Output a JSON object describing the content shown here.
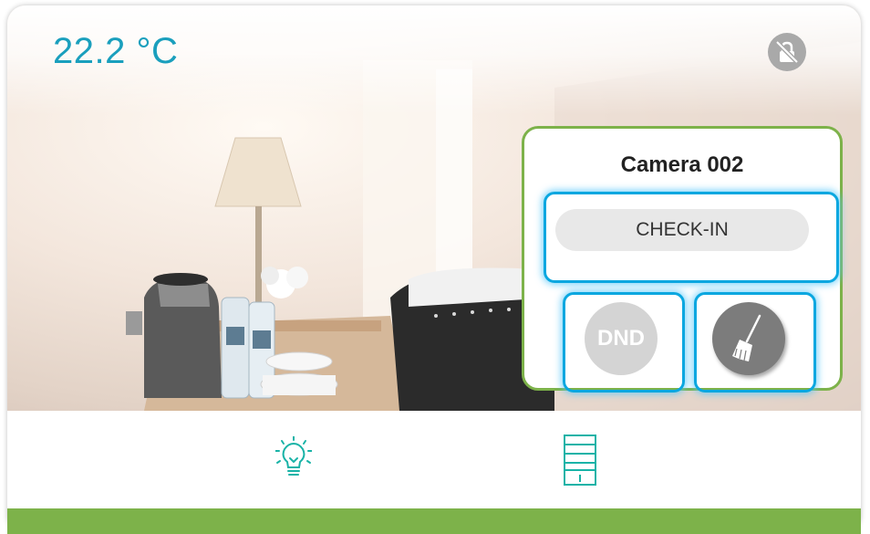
{
  "temperature": {
    "value": "22.2 °C"
  },
  "panel": {
    "title": "Camera 002",
    "checkin_label": "CHECK-IN",
    "dnd_label": "DND"
  },
  "icons": {
    "lock": "lock-crossed-icon",
    "broom": "broom-icon",
    "light": "light-bulb-icon",
    "blind": "blind-shutter-icon"
  },
  "colors": {
    "accent": "#1a9fbd",
    "green": "#7db24a",
    "highlight": "#0aa7e0"
  }
}
